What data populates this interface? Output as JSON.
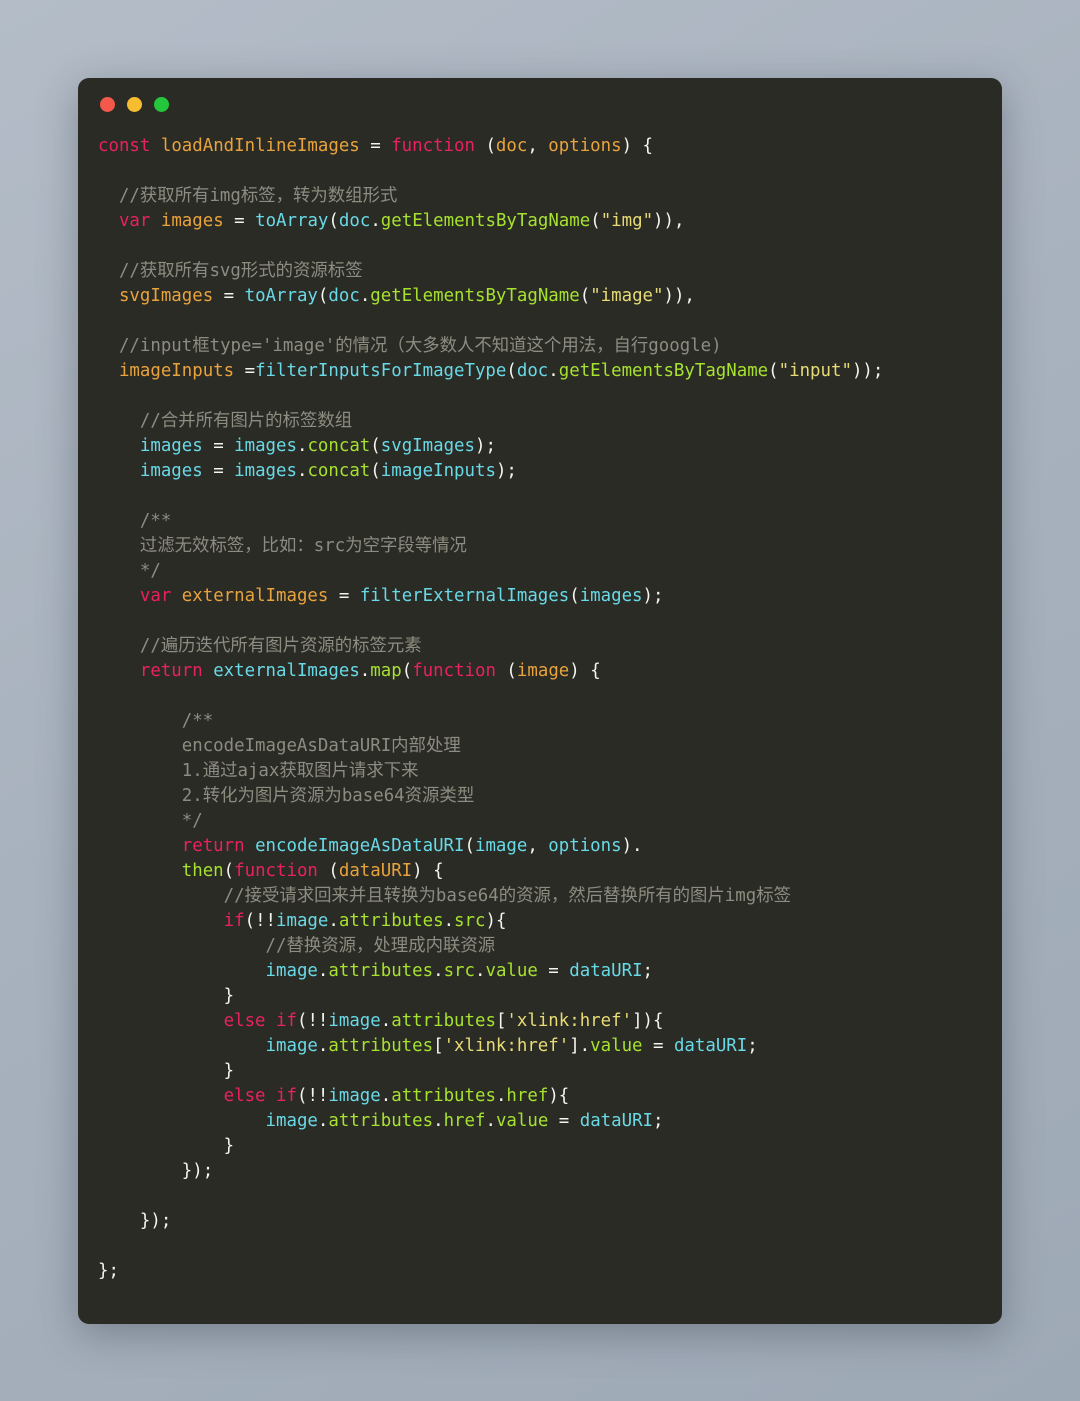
{
  "window": {
    "name": "code-snippet-window",
    "background_color": "#2b2b26",
    "page_background_color": "#a8b2be",
    "traffic_lights": [
      {
        "name": "close-button-dot",
        "label": "Close",
        "color": "#f2594b"
      },
      {
        "name": "minimize-button-dot",
        "label": "Minimize",
        "color": "#f5bd2f"
      },
      {
        "name": "zoom-button-dot",
        "label": "Zoom",
        "color": "#24c63c"
      }
    ]
  },
  "theme": {
    "keyword": "#e8215f",
    "declaration": "#e8a33d",
    "identifier": "#68d9e6",
    "method": "#a6e22e",
    "string": "#e6db74",
    "comment": "#8c8c80",
    "punctuation": "#f5f5ef"
  },
  "code": {
    "language": "javascript",
    "lines": [
      [
        {
          "t": "const",
          "c": "kw"
        },
        {
          "t": " ",
          "c": "pun"
        },
        {
          "t": "loadAndInlineImages",
          "c": "fn"
        },
        {
          "t": " = ",
          "c": "pun"
        },
        {
          "t": "function",
          "c": "kw"
        },
        {
          "t": " (",
          "c": "pun"
        },
        {
          "t": "doc",
          "c": "fn"
        },
        {
          "t": ", ",
          "c": "pun"
        },
        {
          "t": "options",
          "c": "fn"
        },
        {
          "t": ") {",
          "c": "pun"
        }
      ],
      [],
      [
        {
          "t": "  //获取所有img标签，转为数组形式",
          "c": "cmt"
        }
      ],
      [
        {
          "t": "  ",
          "c": "pun"
        },
        {
          "t": "var",
          "c": "kw"
        },
        {
          "t": " ",
          "c": "pun"
        },
        {
          "t": "images",
          "c": "fn"
        },
        {
          "t": " = ",
          "c": "pun"
        },
        {
          "t": "toArray",
          "c": "id"
        },
        {
          "t": "(",
          "c": "pun"
        },
        {
          "t": "doc",
          "c": "id"
        },
        {
          "t": ".",
          "c": "pun"
        },
        {
          "t": "getElementsByTagName",
          "c": "meth"
        },
        {
          "t": "(",
          "c": "pun"
        },
        {
          "t": "\"img\"",
          "c": "str"
        },
        {
          "t": ")),",
          "c": "pun"
        }
      ],
      [],
      [
        {
          "t": "  //获取所有svg形式的资源标签",
          "c": "cmt"
        }
      ],
      [
        {
          "t": "  ",
          "c": "pun"
        },
        {
          "t": "svgImages",
          "c": "fn"
        },
        {
          "t": " = ",
          "c": "pun"
        },
        {
          "t": "toArray",
          "c": "id"
        },
        {
          "t": "(",
          "c": "pun"
        },
        {
          "t": "doc",
          "c": "id"
        },
        {
          "t": ".",
          "c": "pun"
        },
        {
          "t": "getElementsByTagName",
          "c": "meth"
        },
        {
          "t": "(",
          "c": "pun"
        },
        {
          "t": "\"image\"",
          "c": "str"
        },
        {
          "t": ")),",
          "c": "pun"
        }
      ],
      [],
      [
        {
          "t": "  //input框type='image'的情况（大多数人不知道这个用法，自行google)",
          "c": "cmt"
        }
      ],
      [
        {
          "t": "  ",
          "c": "pun"
        },
        {
          "t": "imageInputs",
          "c": "fn"
        },
        {
          "t": " =",
          "c": "pun"
        },
        {
          "t": "filterInputsForImageType",
          "c": "id"
        },
        {
          "t": "(",
          "c": "pun"
        },
        {
          "t": "doc",
          "c": "id"
        },
        {
          "t": ".",
          "c": "pun"
        },
        {
          "t": "getElementsByTagName",
          "c": "meth"
        },
        {
          "t": "(",
          "c": "pun"
        },
        {
          "t": "\"input\"",
          "c": "str"
        },
        {
          "t": "));",
          "c": "pun"
        }
      ],
      [],
      [
        {
          "t": "    //合并所有图片的标签数组",
          "c": "cmt"
        }
      ],
      [
        {
          "t": "    ",
          "c": "pun"
        },
        {
          "t": "images",
          "c": "id"
        },
        {
          "t": " = ",
          "c": "pun"
        },
        {
          "t": "images",
          "c": "id"
        },
        {
          "t": ".",
          "c": "pun"
        },
        {
          "t": "concat",
          "c": "meth"
        },
        {
          "t": "(",
          "c": "pun"
        },
        {
          "t": "svgImages",
          "c": "id"
        },
        {
          "t": ");",
          "c": "pun"
        }
      ],
      [
        {
          "t": "    ",
          "c": "pun"
        },
        {
          "t": "images",
          "c": "id"
        },
        {
          "t": " = ",
          "c": "pun"
        },
        {
          "t": "images",
          "c": "id"
        },
        {
          "t": ".",
          "c": "pun"
        },
        {
          "t": "concat",
          "c": "meth"
        },
        {
          "t": "(",
          "c": "pun"
        },
        {
          "t": "imageInputs",
          "c": "id"
        },
        {
          "t": ");",
          "c": "pun"
        }
      ],
      [],
      [
        {
          "t": "    /**",
          "c": "cmt"
        }
      ],
      [
        {
          "t": "    过滤无效标签，比如：src为空字段等情况",
          "c": "cmt"
        }
      ],
      [
        {
          "t": "    */",
          "c": "cmt"
        }
      ],
      [
        {
          "t": "    ",
          "c": "pun"
        },
        {
          "t": "var",
          "c": "kw"
        },
        {
          "t": " ",
          "c": "pun"
        },
        {
          "t": "externalImages",
          "c": "fn"
        },
        {
          "t": " = ",
          "c": "pun"
        },
        {
          "t": "filterExternalImages",
          "c": "id"
        },
        {
          "t": "(",
          "c": "pun"
        },
        {
          "t": "images",
          "c": "id"
        },
        {
          "t": ");",
          "c": "pun"
        }
      ],
      [],
      [
        {
          "t": "    //遍历迭代所有图片资源的标签元素",
          "c": "cmt"
        }
      ],
      [
        {
          "t": "    ",
          "c": "pun"
        },
        {
          "t": "return",
          "c": "kw"
        },
        {
          "t": " ",
          "c": "pun"
        },
        {
          "t": "externalImages",
          "c": "id"
        },
        {
          "t": ".",
          "c": "pun"
        },
        {
          "t": "map",
          "c": "meth"
        },
        {
          "t": "(",
          "c": "pun"
        },
        {
          "t": "function",
          "c": "kw"
        },
        {
          "t": " (",
          "c": "pun"
        },
        {
          "t": "image",
          "c": "fn"
        },
        {
          "t": ") {",
          "c": "pun"
        }
      ],
      [],
      [
        {
          "t": "        /**",
          "c": "cmt"
        }
      ],
      [
        {
          "t": "        encodeImageAsDataURI内部处理",
          "c": "cmt"
        }
      ],
      [
        {
          "t": "        1.通过ajax获取图片请求下来",
          "c": "cmt"
        }
      ],
      [
        {
          "t": "        2.转化为图片资源为base64资源类型",
          "c": "cmt"
        }
      ],
      [
        {
          "t": "        */",
          "c": "cmt"
        }
      ],
      [
        {
          "t": "        ",
          "c": "pun"
        },
        {
          "t": "return",
          "c": "kw"
        },
        {
          "t": " ",
          "c": "pun"
        },
        {
          "t": "encodeImageAsDataURI",
          "c": "id"
        },
        {
          "t": "(",
          "c": "pun"
        },
        {
          "t": "image",
          "c": "id"
        },
        {
          "t": ", ",
          "c": "pun"
        },
        {
          "t": "options",
          "c": "id"
        },
        {
          "t": ").",
          "c": "pun"
        }
      ],
      [
        {
          "t": "        ",
          "c": "pun"
        },
        {
          "t": "then",
          "c": "meth"
        },
        {
          "t": "(",
          "c": "pun"
        },
        {
          "t": "function",
          "c": "kw"
        },
        {
          "t": " (",
          "c": "pun"
        },
        {
          "t": "dataURI",
          "c": "fn"
        },
        {
          "t": ") {",
          "c": "pun"
        }
      ],
      [
        {
          "t": "            //接受请求回来并且转换为base64的资源，然后替换所有的图片img标签",
          "c": "cmt"
        }
      ],
      [
        {
          "t": "            ",
          "c": "pun"
        },
        {
          "t": "if",
          "c": "kw"
        },
        {
          "t": "(!!",
          "c": "pun"
        },
        {
          "t": "image",
          "c": "id"
        },
        {
          "t": ".",
          "c": "pun"
        },
        {
          "t": "attributes",
          "c": "meth"
        },
        {
          "t": ".",
          "c": "pun"
        },
        {
          "t": "src",
          "c": "meth"
        },
        {
          "t": "){",
          "c": "pun"
        }
      ],
      [
        {
          "t": "                //替换资源，处理成内联资源",
          "c": "cmt"
        }
      ],
      [
        {
          "t": "                ",
          "c": "pun"
        },
        {
          "t": "image",
          "c": "id"
        },
        {
          "t": ".",
          "c": "pun"
        },
        {
          "t": "attributes",
          "c": "meth"
        },
        {
          "t": ".",
          "c": "pun"
        },
        {
          "t": "src",
          "c": "meth"
        },
        {
          "t": ".",
          "c": "pun"
        },
        {
          "t": "value",
          "c": "meth"
        },
        {
          "t": " = ",
          "c": "pun"
        },
        {
          "t": "dataURI",
          "c": "id"
        },
        {
          "t": ";",
          "c": "pun"
        }
      ],
      [
        {
          "t": "            }",
          "c": "pun"
        }
      ],
      [
        {
          "t": "            ",
          "c": "pun"
        },
        {
          "t": "else",
          "c": "kw"
        },
        {
          "t": " ",
          "c": "pun"
        },
        {
          "t": "if",
          "c": "kw"
        },
        {
          "t": "(!!",
          "c": "pun"
        },
        {
          "t": "image",
          "c": "id"
        },
        {
          "t": ".",
          "c": "pun"
        },
        {
          "t": "attributes",
          "c": "meth"
        },
        {
          "t": "[",
          "c": "pun"
        },
        {
          "t": "'xlink:href'",
          "c": "str"
        },
        {
          "t": "]){",
          "c": "pun"
        }
      ],
      [
        {
          "t": "                ",
          "c": "pun"
        },
        {
          "t": "image",
          "c": "id"
        },
        {
          "t": ".",
          "c": "pun"
        },
        {
          "t": "attributes",
          "c": "meth"
        },
        {
          "t": "[",
          "c": "pun"
        },
        {
          "t": "'xlink:href'",
          "c": "str"
        },
        {
          "t": "].",
          "c": "pun"
        },
        {
          "t": "value",
          "c": "meth"
        },
        {
          "t": " = ",
          "c": "pun"
        },
        {
          "t": "dataURI",
          "c": "id"
        },
        {
          "t": ";",
          "c": "pun"
        }
      ],
      [
        {
          "t": "            }",
          "c": "pun"
        }
      ],
      [
        {
          "t": "            ",
          "c": "pun"
        },
        {
          "t": "else",
          "c": "kw"
        },
        {
          "t": " ",
          "c": "pun"
        },
        {
          "t": "if",
          "c": "kw"
        },
        {
          "t": "(!!",
          "c": "pun"
        },
        {
          "t": "image",
          "c": "id"
        },
        {
          "t": ".",
          "c": "pun"
        },
        {
          "t": "attributes",
          "c": "meth"
        },
        {
          "t": ".",
          "c": "pun"
        },
        {
          "t": "href",
          "c": "meth"
        },
        {
          "t": "){",
          "c": "pun"
        }
      ],
      [
        {
          "t": "                ",
          "c": "pun"
        },
        {
          "t": "image",
          "c": "id"
        },
        {
          "t": ".",
          "c": "pun"
        },
        {
          "t": "attributes",
          "c": "meth"
        },
        {
          "t": ".",
          "c": "pun"
        },
        {
          "t": "href",
          "c": "meth"
        },
        {
          "t": ".",
          "c": "pun"
        },
        {
          "t": "value",
          "c": "meth"
        },
        {
          "t": " = ",
          "c": "pun"
        },
        {
          "t": "dataURI",
          "c": "id"
        },
        {
          "t": ";",
          "c": "pun"
        }
      ],
      [
        {
          "t": "            }",
          "c": "pun"
        }
      ],
      [
        {
          "t": "        });",
          "c": "pun"
        }
      ],
      [],
      [
        {
          "t": "    });",
          "c": "pun"
        }
      ],
      [],
      [
        {
          "t": "};",
          "c": "pun"
        }
      ]
    ]
  }
}
